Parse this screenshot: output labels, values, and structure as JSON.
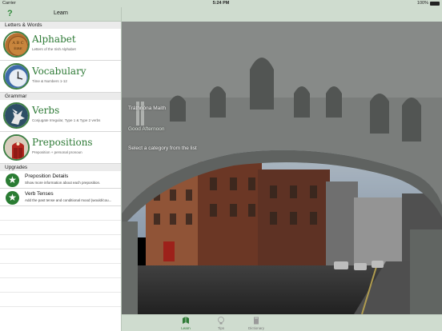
{
  "status_bar": {
    "carrier": "Carrier",
    "time": "5:24 PM",
    "battery": "100%"
  },
  "nav": {
    "help_label": "?",
    "title": "Learn"
  },
  "sections": {
    "letters_words": "Letters & Words",
    "grammar": "Grammar",
    "upgrades": "Upgrades"
  },
  "rows": [
    {
      "title": "Alphabet",
      "subtitle": "Letters of the Irish Alphabet",
      "icon": "alphabet-coin-icon"
    },
    {
      "title": "Vocabulary",
      "subtitle": "Time & Numbers 1-12",
      "icon": "clock-icon"
    },
    {
      "title": "Verbs",
      "subtitle": "Conjugate Irregular, Type 1 & Type 2 verbs",
      "icon": "pegasus-icon"
    },
    {
      "title": "Prepositions",
      "subtitle": "Preposition + personal pronoun",
      "icon": "door-icon"
    }
  ],
  "upgrades": [
    {
      "title": "Preposition Details",
      "subtitle": "Show more information about each preposition."
    },
    {
      "title": "Verb Tenses",
      "subtitle": "Add the past tense and conditional mood (would/cou..."
    }
  ],
  "detail": {
    "greeting_irish": "Tráthnóna Maith",
    "greeting_english": "Good Afternoon",
    "prompt": "Select a category from the list"
  },
  "tabs": [
    {
      "label": "Learn",
      "active": true
    },
    {
      "label": "Tips",
      "active": false
    },
    {
      "label": "Dictionary",
      "active": false
    }
  ],
  "colors": {
    "accent": "#2e7a36",
    "bar": "#cfdccf"
  }
}
